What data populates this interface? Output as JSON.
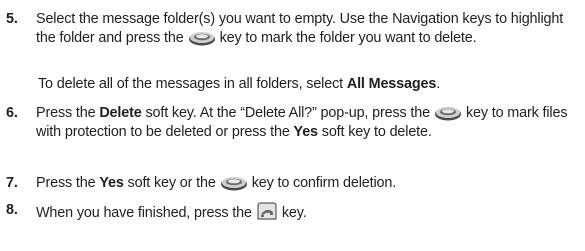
{
  "steps": [
    {
      "number": "5.",
      "parts": {
        "a": "Select the message folder(s) you want to empty. Use the Navigation keys to highlight the folder and press the",
        "b": "key to mark the folder you want to delete."
      }
    },
    {
      "number": "6.",
      "parts": {
        "a": "Press the",
        "b": "Delete",
        "c": "soft key. At the “Delete All?” pop-up, press the",
        "d": "key to mark files with protection to be deleted or press the",
        "e": "Yes",
        "f": "soft key to delete."
      }
    },
    {
      "number": "7.",
      "parts": {
        "a": "Press the",
        "b": "Yes",
        "c": "soft key or the",
        "d": "key to confirm deletion."
      }
    },
    {
      "number": "8.",
      "parts": {
        "a": "When you have finished, press the",
        "b": "key."
      }
    }
  ],
  "note": {
    "a": "To delete all of the messages in all folders, select",
    "b": "All Messages",
    "c": "."
  },
  "icons": {
    "ok_key": "ok-key-icon",
    "end_key": "end-key-icon"
  }
}
